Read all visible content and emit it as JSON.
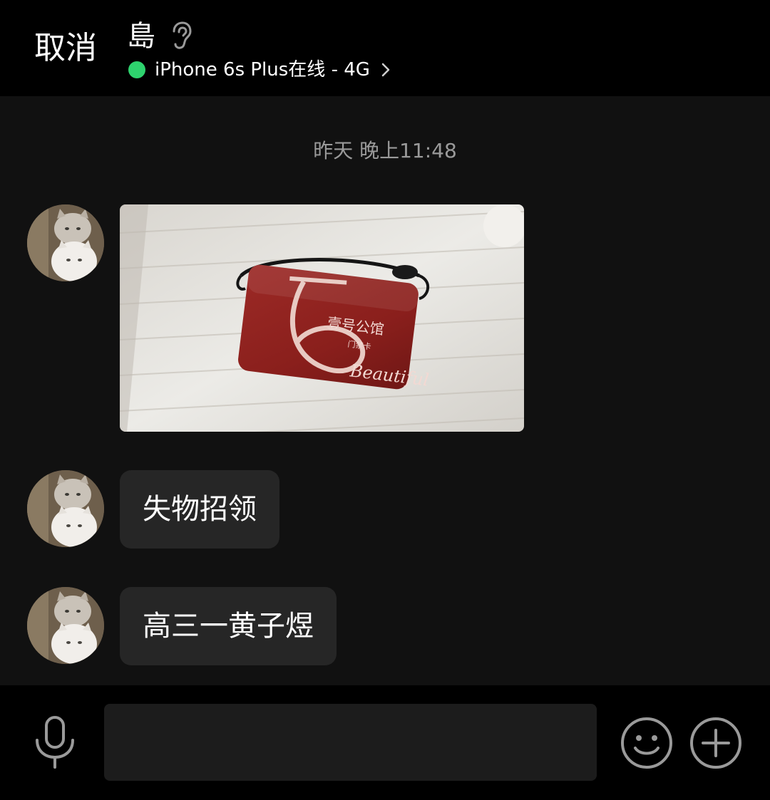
{
  "header": {
    "cancel_label": "取消",
    "contact_name": "島",
    "status_text": "iPhone 6s Plus在线 - 4G",
    "status_color": "#2ed36e",
    "ear_icon": "ear-icon",
    "chevron_icon": "chevron-right-icon"
  },
  "chat": {
    "timestamp": "昨天 晚上11:48",
    "messages": [
      {
        "type": "image",
        "card_text": "壹号公馆",
        "card_subtext": "门禁卡",
        "card_script": "Beautiful"
      },
      {
        "type": "text",
        "text": "失物招领"
      },
      {
        "type": "text",
        "text": "高三一黄子煜"
      }
    ]
  },
  "input_bar": {
    "input_value": "",
    "mic_icon": "microphone-icon",
    "emoji_icon": "emoji-icon",
    "plus_icon": "plus-icon"
  }
}
